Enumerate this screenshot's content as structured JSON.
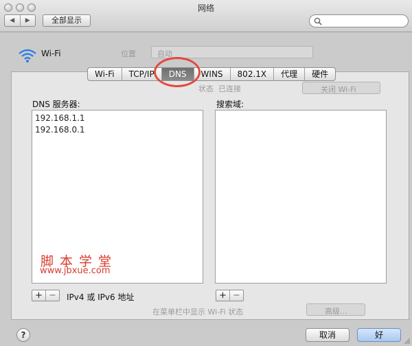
{
  "window": {
    "title": "网络"
  },
  "toolbar": {
    "back_glyph": "◀",
    "forward_glyph": "▶",
    "show_all_label": "全部显示",
    "search_placeholder": ""
  },
  "header": {
    "interface_name": "Wi-Fi"
  },
  "tabs": [
    {
      "label": "Wi-Fi",
      "active": false
    },
    {
      "label": "TCP/IP",
      "active": false
    },
    {
      "label": "DNS",
      "active": true
    },
    {
      "label": "WINS",
      "active": false
    },
    {
      "label": "802.1X",
      "active": false
    },
    {
      "label": "代理",
      "active": false
    },
    {
      "label": "硬件",
      "active": false
    }
  ],
  "dns": {
    "label": "DNS 服务器:",
    "servers": [
      "192.168.1.1",
      "192.168.0.1"
    ],
    "add_glyph": "+",
    "remove_glyph": "−",
    "hint": "IPv4 或 IPv6 地址"
  },
  "search_domains": {
    "label": "搜索域:",
    "add_glyph": "+",
    "remove_glyph": "−"
  },
  "watermark": {
    "text": "脚本学堂",
    "url": "www.jbxue.com"
  },
  "footer": {
    "help_glyph": "?",
    "cancel_label": "取消",
    "ok_label": "好"
  },
  "background_ghost": {
    "location_label": "位置",
    "location_value": "自动",
    "status_label": "状态",
    "status_value": "已连接",
    "turn_off_label": "关闭 Wi-Fi",
    "show_menu_label": "在菜单栏中显示 Wi-Fi 状态",
    "advanced_label": "高级..."
  },
  "colors": {
    "accent_ring": "#e24a3d",
    "watermark": "#d83a2c",
    "active_tab": "#7a7a7a"
  }
}
